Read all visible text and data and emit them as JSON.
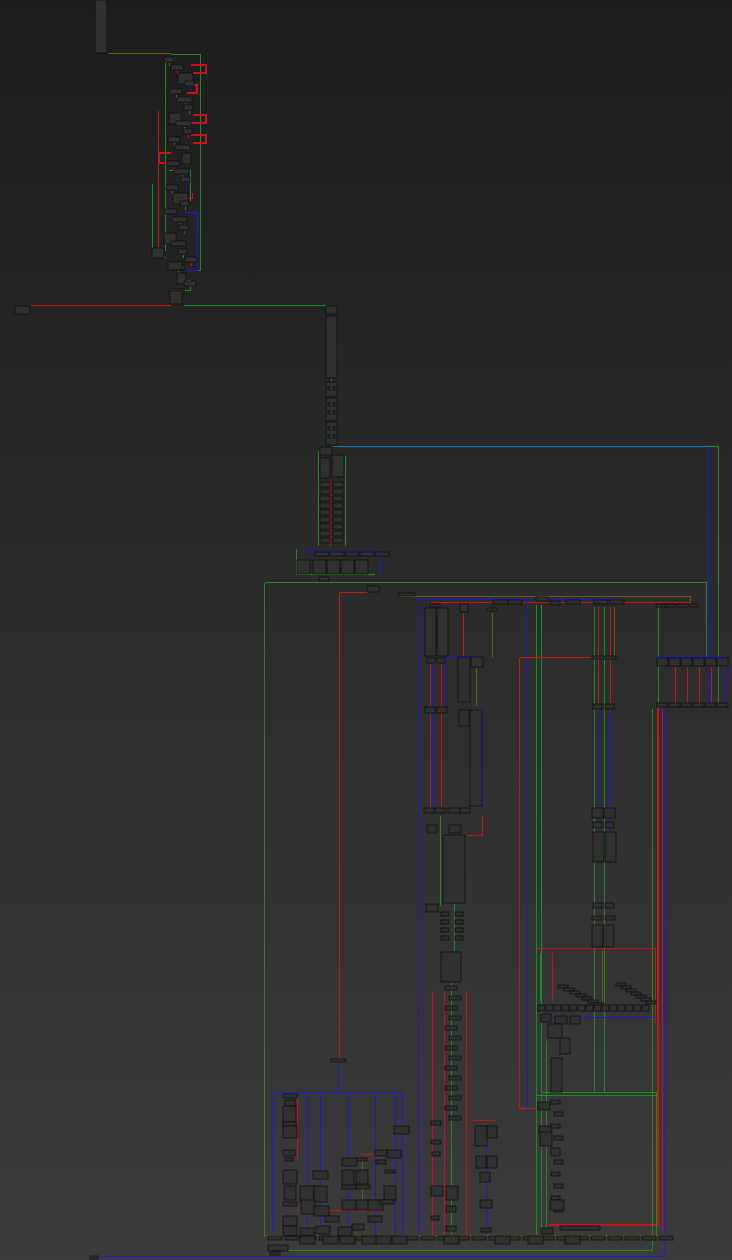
{
  "graph_view": {
    "edge_types": [
      {
        "color": "#1f8a1f"
      },
      {
        "color": "#c81414"
      },
      {
        "color": "#1a1ad0"
      },
      {
        "color": "#6b5a10"
      }
    ]
  }
}
